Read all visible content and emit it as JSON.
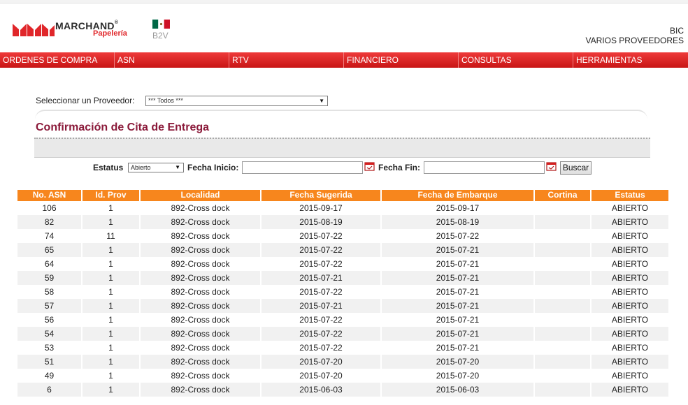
{
  "header": {
    "logo_text": "MARCHAND",
    "logo_reg": "®",
    "logo_sub": "Papelería",
    "portal": "B2V",
    "user_line1": "BIC",
    "user_line2": "VARIOS PROVEEDORES",
    "flag_colors": [
      "#006847",
      "#ffffff",
      "#ce1126"
    ]
  },
  "nav": {
    "items": [
      {
        "label": "ORDENES DE COMPRA"
      },
      {
        "label": "ASN"
      },
      {
        "label": "RTV"
      },
      {
        "label": "FINANCIERO"
      },
      {
        "label": "CONSULTAS"
      },
      {
        "label": "HERRAMIENTAS"
      }
    ]
  },
  "provider": {
    "label": "Seleccionar un Proveedor:",
    "selected": "*** Todos ***"
  },
  "panel": {
    "title": "Confirmación de Cita de Entrega"
  },
  "filters": {
    "status_label": "Estatus",
    "status_value": "Abierto",
    "start_label": "Fecha Inicio:",
    "start_value": "",
    "end_label": "Fecha Fin:",
    "end_value": "",
    "search_button": "Buscar"
  },
  "table": {
    "columns": [
      "No. ASN",
      "Id. Prov",
      "Localidad",
      "Fecha Sugerida",
      "Fecha de Embarque",
      "Cortina",
      "Estatus"
    ],
    "rows": [
      [
        "106",
        "1",
        "892-Cross dock",
        "2015-09-17",
        "2015-09-17",
        "",
        "ABIERTO"
      ],
      [
        "82",
        "1",
        "892-Cross dock",
        "2015-08-19",
        "2015-08-19",
        "",
        "ABIERTO"
      ],
      [
        "74",
        "11",
        "892-Cross dock",
        "2015-07-22",
        "2015-07-22",
        "",
        "ABIERTO"
      ],
      [
        "65",
        "1",
        "892-Cross dock",
        "2015-07-22",
        "2015-07-21",
        "",
        "ABIERTO"
      ],
      [
        "64",
        "1",
        "892-Cross dock",
        "2015-07-22",
        "2015-07-21",
        "",
        "ABIERTO"
      ],
      [
        "59",
        "1",
        "892-Cross dock",
        "2015-07-21",
        "2015-07-21",
        "",
        "ABIERTO"
      ],
      [
        "58",
        "1",
        "892-Cross dock",
        "2015-07-22",
        "2015-07-21",
        "",
        "ABIERTO"
      ],
      [
        "57",
        "1",
        "892-Cross dock",
        "2015-07-21",
        "2015-07-21",
        "",
        "ABIERTO"
      ],
      [
        "56",
        "1",
        "892-Cross dock",
        "2015-07-22",
        "2015-07-21",
        "",
        "ABIERTO"
      ],
      [
        "54",
        "1",
        "892-Cross dock",
        "2015-07-22",
        "2015-07-21",
        "",
        "ABIERTO"
      ],
      [
        "53",
        "1",
        "892-Cross dock",
        "2015-07-22",
        "2015-07-21",
        "",
        "ABIERTO"
      ],
      [
        "51",
        "1",
        "892-Cross dock",
        "2015-07-20",
        "2015-07-20",
        "",
        "ABIERTO"
      ],
      [
        "49",
        "1",
        "892-Cross dock",
        "2015-07-20",
        "2015-07-20",
        "",
        "ABIERTO"
      ],
      [
        "6",
        "1",
        "892-Cross dock",
        "2015-06-03",
        "2015-06-03",
        "",
        "ABIERTO"
      ]
    ]
  }
}
